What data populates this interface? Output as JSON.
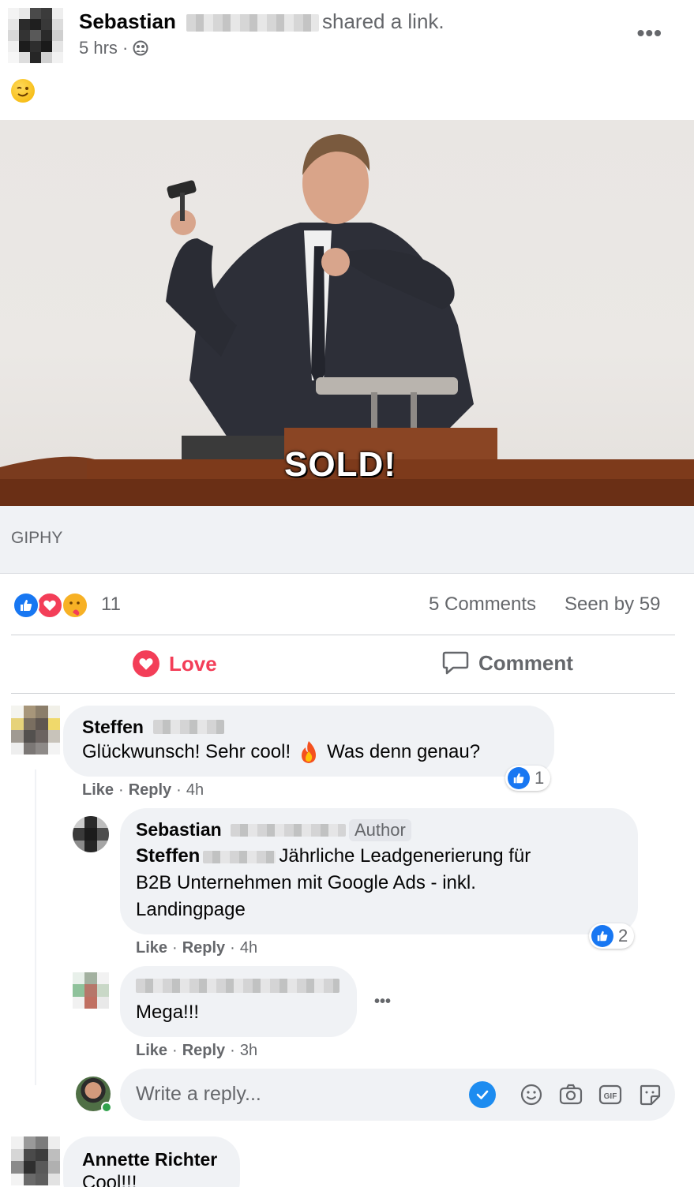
{
  "post": {
    "author": "Sebastian",
    "action": "shared a link.",
    "time": "5 hrs ·",
    "menu_dots": "•••",
    "media_caption_overlay": "SOLD!",
    "link_source": "GIPHY"
  },
  "stats": {
    "reaction_count": "11",
    "comments": "5 Comments",
    "seen_by": "Seen by 59"
  },
  "actions": {
    "love": "Love",
    "comment": "Comment"
  },
  "comments": [
    {
      "name": "Steffen",
      "text_a": "Glückwunsch! Sehr cool!",
      "text_b": "Was denn genau?",
      "like_label": "Like",
      "reply_label": "Reply",
      "time": "4h",
      "likes": "1"
    },
    {
      "name": "Sebastian",
      "badge": "Author",
      "mention": "Steffen",
      "text": "Jährliche Leadgenerierung für",
      "text_line2": "B2B Unternehmen mit Google Ads - inkl.",
      "text_line3": "Landingpage",
      "like_label": "Like",
      "reply_label": "Reply",
      "time": "4h",
      "likes": "2"
    },
    {
      "text": "Mega!!!",
      "like_label": "Like",
      "reply_label": "Reply",
      "time": "3h",
      "menu_dots": "•••"
    },
    {
      "name": "Annette Richter",
      "text": "Cool!!!"
    }
  ],
  "reply_box": {
    "placeholder": "Write a reply..."
  },
  "colors": {
    "love_red": "#f33e58",
    "like_blue": "#1877f2",
    "muted_text": "#65676b",
    "bubble_bg": "#f0f2f5"
  }
}
